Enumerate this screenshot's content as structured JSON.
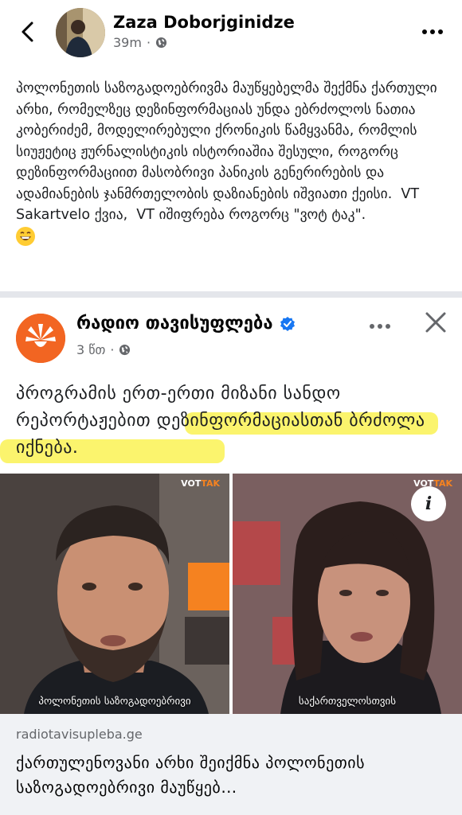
{
  "post": {
    "author": "Zaza Doborjginidze",
    "time": "39m",
    "audience_icon": "globe-icon",
    "text": "პოლონეთის საზოგადოებრივმა მაუწყებელმა შექმნა ქართული არხი, რომელზეც დეზინფორმაციას უნდა ებრძოლოს ნათია კობერიძემ, მოდელირებული ქრონიკის წამყვანმა, რომლის სიუჟეტიც ჟურნალისტიკის ისტორიაშია შესული, როგორც დეზინფორმაციით მასობრივი პანიკის გენერირების და ადამიანების ჯანმრთელობის დაზიანების იშვიათი ქეისი.  VT Sakartvelo ქვია,  VT იშიფრება როგორც \"ვოტ ტაკ\".",
    "emoji": "grinning-face-emoji"
  },
  "shared": {
    "page_name": "რადიო თავისუფლება",
    "verified_icon": "verified-badge-icon",
    "time": "3 წთ",
    "text_plain": "პროგრამის ერთ-ერთი მიზანი სანდო რეპორტაჟებით ",
    "text_highlight": "დეზინფორმაციასთან ბრძოლა იქნება.",
    "image_left": {
      "watermark_a": "VOT",
      "watermark_b": "TAK",
      "caption": "პოლონეთის საზოგადოებრივი"
    },
    "image_right": {
      "watermark_a": "VOT",
      "watermark_b": "TAK",
      "caption": "საქართველოსთვის"
    },
    "info_label": "i",
    "link_domain": "radiotavisupleba.ge",
    "link_title": "ქართულენოვანი არხი შეიქმნა პოლონეთის საზოგადოებრივი მაუწყებ…"
  },
  "colors": {
    "accent_blue": "#1877f2",
    "highlight": "#f5ec3c",
    "rfe_orange": "#f26522"
  }
}
